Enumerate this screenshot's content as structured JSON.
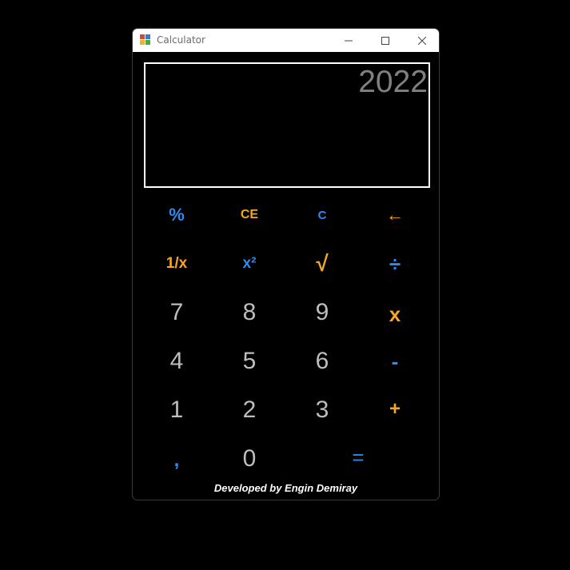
{
  "window": {
    "title": "Calculator",
    "icon": "calculator-app-icon"
  },
  "display": {
    "value": "2022"
  },
  "keys": {
    "percent": "%",
    "ce": "CE",
    "c": "C",
    "backspace": "←",
    "reciprocal": "1/x",
    "square": "x²",
    "sqrt": "√",
    "divide": "÷",
    "seven": "7",
    "eight": "8",
    "nine": "9",
    "multiply": "x",
    "four": "4",
    "five": "5",
    "six": "6",
    "minus": "-",
    "one": "1",
    "two": "2",
    "three": "3",
    "plus": "+",
    "comma": ",",
    "zero": "0",
    "equals": "="
  },
  "footer": "Developed by Engin Demiray",
  "colors": {
    "accent_blue": "#2d8cf0",
    "accent_orange": "#f5a623",
    "digit": "#bdbdbd",
    "display_text": "#808080"
  }
}
